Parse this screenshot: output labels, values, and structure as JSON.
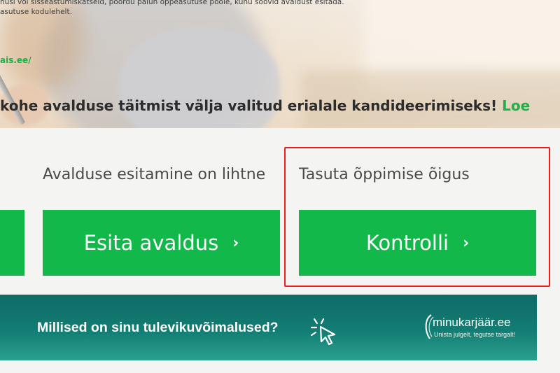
{
  "hero": {
    "text_line1": "nusi või sisseastumiskatseid, pöördu palun õppeasutuse poole, kuhu soovid avaldust esitada.",
    "text_line2": "asutuse kodulehelt.",
    "link_text": "ais.ee/",
    "headline": "kohe avalduse täitmist välja valitud erialale kandideerimiseks!",
    "headline_link": "Loe"
  },
  "actions": {
    "application_label": "Avalduse esitamine on lihtne",
    "application_button": "Esita avaldus",
    "tuition_label": "Tasuta õppimise õigus",
    "tuition_button": "Kontrolli",
    "chevron": "›"
  },
  "banner": {
    "text": "Millised on sinu tulevikuvõimalused?",
    "brand_name": "minukarjäär.ee",
    "brand_slogan": "Unista julgelt, tegutse targalt!"
  },
  "colors": {
    "green": "#13b84a",
    "link_green": "#1db148",
    "banner_teal": "#137d73",
    "highlight_red": "#f01c1c"
  }
}
